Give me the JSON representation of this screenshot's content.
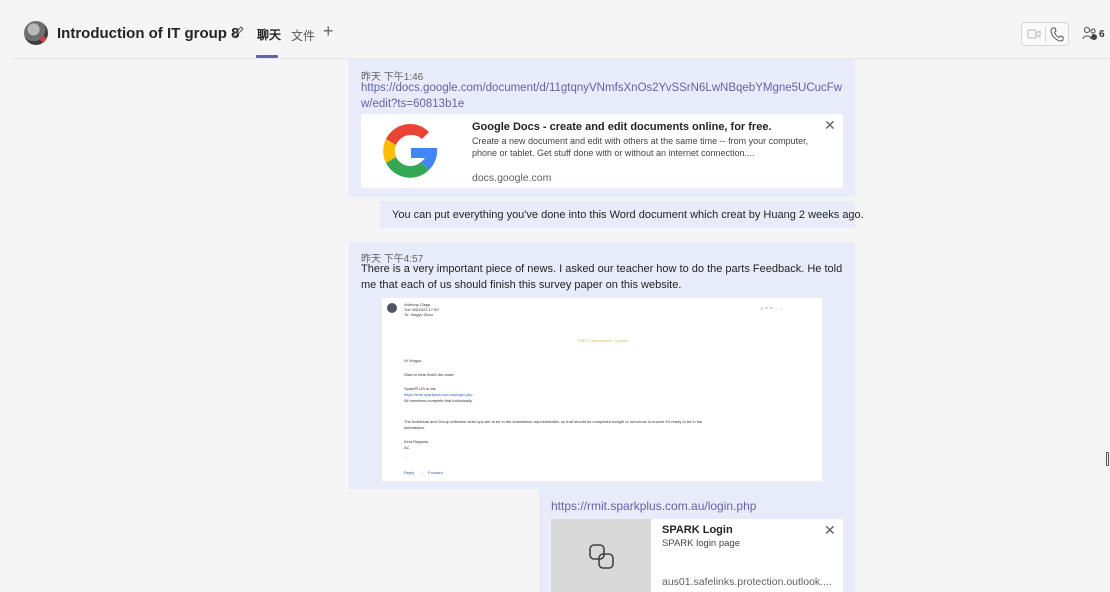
{
  "header": {
    "title": "Introduction of IT group 8",
    "tabs": [
      {
        "label": "聊天",
        "active": true
      },
      {
        "label": "文件",
        "active": false
      }
    ],
    "add_tab": "+",
    "participant_count": "6",
    "accent_color": "#6264a7"
  },
  "messages": [
    {
      "time": "昨天 下午1:46",
      "link": "https://docs.google.com/document/d/11gtqnyVNmfsXnOs2YvSSrN6LwNBqebYMgne5UCucFww/edit?ts=60813b1e",
      "preview": {
        "title": "Google Docs - create and edit documents online, for free.",
        "description": "Create a new document and edit with others at the same time -- from your computer, phone or tablet. Get stuff done with or without an internet connection....",
        "domain": "docs.google.com",
        "close": "✕"
      }
    },
    {
      "text": "You can put everything you've done into this Word document which creat by Huang 2 weeks ago."
    },
    {
      "time": "昨天 下午4:57",
      "text": "There is a very important piece of news. I asked our teacher how to do the parts Feedback. He told me that each of us should finish this survey paper on this website.",
      "email": {
        "sender": "Anthony Clapp",
        "date": "Tue 4/6/2021 17:50",
        "to": "To: Xingyu Zhou",
        "banner": "RMIT Classification: Trusted",
        "greeting": "Hi Xingyu,",
        "line1": "Glad to hear that's the case!",
        "line2": "SparkPLUS is via:",
        "link": "https://rmit.sparkplus.com.au/login.php",
        "line3": "All members complete that individually.",
        "line4": "The Individual and Group reflection write-ups are to be in the submission report/website, so that should be completed tonight or tomorrow to ensure it's ready to be in the",
        "line5": "submission.",
        "signoff": "Kind Regards,",
        "initials": "AC",
        "more": "···",
        "reply": "Reply",
        "forward": "Forward"
      }
    },
    {
      "link": "https://rmit.sparkplus.com.au/login.php",
      "preview": {
        "title": "SPARK Login",
        "description": "SPARK login page",
        "domain": "aus01.safelinks.protection.outlook....",
        "close": "✕"
      }
    }
  ]
}
